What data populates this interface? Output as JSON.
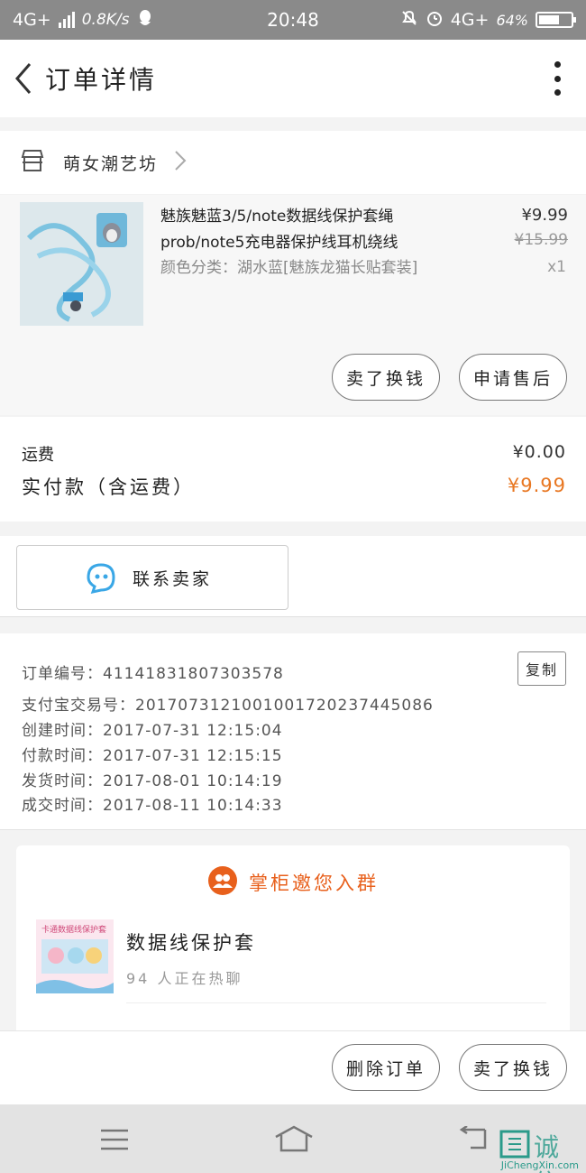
{
  "status_bar": {
    "network": "4G+",
    "speed": "0.8K/s",
    "time": "20:48",
    "network2": "4G+",
    "battery": "64%",
    "battery_level": 0.64
  },
  "nav": {
    "title": "订单详情"
  },
  "shop": {
    "name": "萌女潮艺坊"
  },
  "product": {
    "title": "魅族魅蓝3/5/note数据线保护套绳prob/note5充电器保护线耳机绕线",
    "sku": "颜色分类：湖水蓝[魅族龙猫长贴套装]",
    "price": "¥9.99",
    "original_price": "¥15.99",
    "quantity": "x1",
    "buttons": [
      "卖了换钱",
      "申请售后"
    ]
  },
  "fees": {
    "shipping_label": "运费",
    "shipping_value": "¥0.00",
    "paid_label": "实付款（含运费）",
    "paid_value": "¥9.99"
  },
  "contact": {
    "label": "联系卖家"
  },
  "order_info": {
    "rows": [
      "订单编号：41141831807303578",
      "支付宝交易号：2017073121001001720237445086",
      "创建时间：2017-07-31  12:15:04",
      "付款时间：2017-07-31  12:15:15",
      "发货时间：2017-08-01  10:14:19",
      "成交时间：2017-08-11  10:14:33"
    ],
    "copy_label": "复制"
  },
  "group": {
    "title": "掌柜邀您入群",
    "name": "数据线保护套",
    "count": "94  人正在热聊",
    "thumb_caption": "卡通数据线保护套"
  },
  "bottom_actions": [
    "删除订单",
    "卖了换钱"
  ],
  "watermark": {
    "text": "诚信",
    "url_text": "JiChengXin.com"
  },
  "colors": {
    "accent_orange": "#e87722",
    "contact_blue": "#3aa7e6"
  }
}
